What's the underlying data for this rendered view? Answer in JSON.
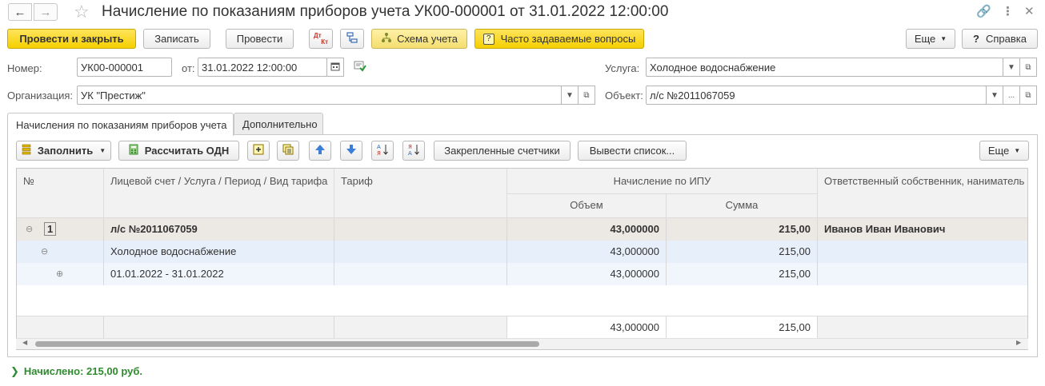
{
  "window": {
    "title": "Начисление по показаниям приборов учета УК00-000001 от 31.01.2022 12:00:00",
    "icons": [
      "arrow-left-icon",
      "arrow-right-icon",
      "star-icon",
      "link-icon",
      "more-vertical-icon",
      "close-icon"
    ]
  },
  "toolbar": {
    "post_close": "Провести и закрыть",
    "save": "Записать",
    "post": "Провести",
    "dt_kt": "Дт Кт",
    "scheme": "Схема учета",
    "faq": "Часто задаваемые вопросы",
    "more": "Еще",
    "help": "Справка",
    "faq_mark": "?"
  },
  "form": {
    "number_label": "Номер:",
    "number_value": "УК00-000001",
    "date_label": "от:",
    "date_value": "31.01.2022 12:00:00",
    "org_label": "Организация:",
    "org_value": "УК \"Престиж\"",
    "service_label": "Услуга:",
    "service_value": "Холодное водоснабжение",
    "object_label": "Объект:",
    "object_value": "л/с №2011067059",
    "ellipsis": "..."
  },
  "tabs": [
    {
      "label": "Начисления по показаниям приборов учета",
      "active": true
    },
    {
      "label": "Дополнительно",
      "active": false
    }
  ],
  "table_toolbar": {
    "fill": "Заполнить",
    "calc_odn": "Рассчитать ОДН",
    "pinned_meters": "Закрепленные счетчики",
    "show_list": "Вывести список...",
    "more": "Еще"
  },
  "table": {
    "headers": {
      "num": "№",
      "account": "Лицевой счет / Услуга / Период / Вид тарифа",
      "tariff": "Тариф",
      "ipu": "Начисление по ИПУ",
      "volume": "Объем",
      "sum": "Сумма",
      "owner": "Ответственный собственник, наниматель"
    },
    "rows": [
      {
        "num": "1",
        "account": "л/с №2011067059",
        "tariff": "",
        "volume": "43,000000",
        "sum": "215,00",
        "owner": "Иванов Иван Иванович"
      },
      {
        "num": "",
        "account": "Холодное водоснабжение",
        "tariff": "",
        "volume": "43,000000",
        "sum": "215,00",
        "owner": ""
      },
      {
        "num": "",
        "account": "01.01.2022 - 31.01.2022",
        "tariff": "",
        "volume": "43,000000",
        "sum": "215,00",
        "owner": ""
      }
    ],
    "totals": {
      "volume": "43,000000",
      "sum": "215,00"
    }
  },
  "status": {
    "text": "Начислено: 215,00 руб."
  },
  "colors": {
    "accent_yellow": "#f5d000",
    "selected_row": "#e6effa",
    "group_row": "#ece9e4",
    "status_green": "#2e8b2e"
  }
}
